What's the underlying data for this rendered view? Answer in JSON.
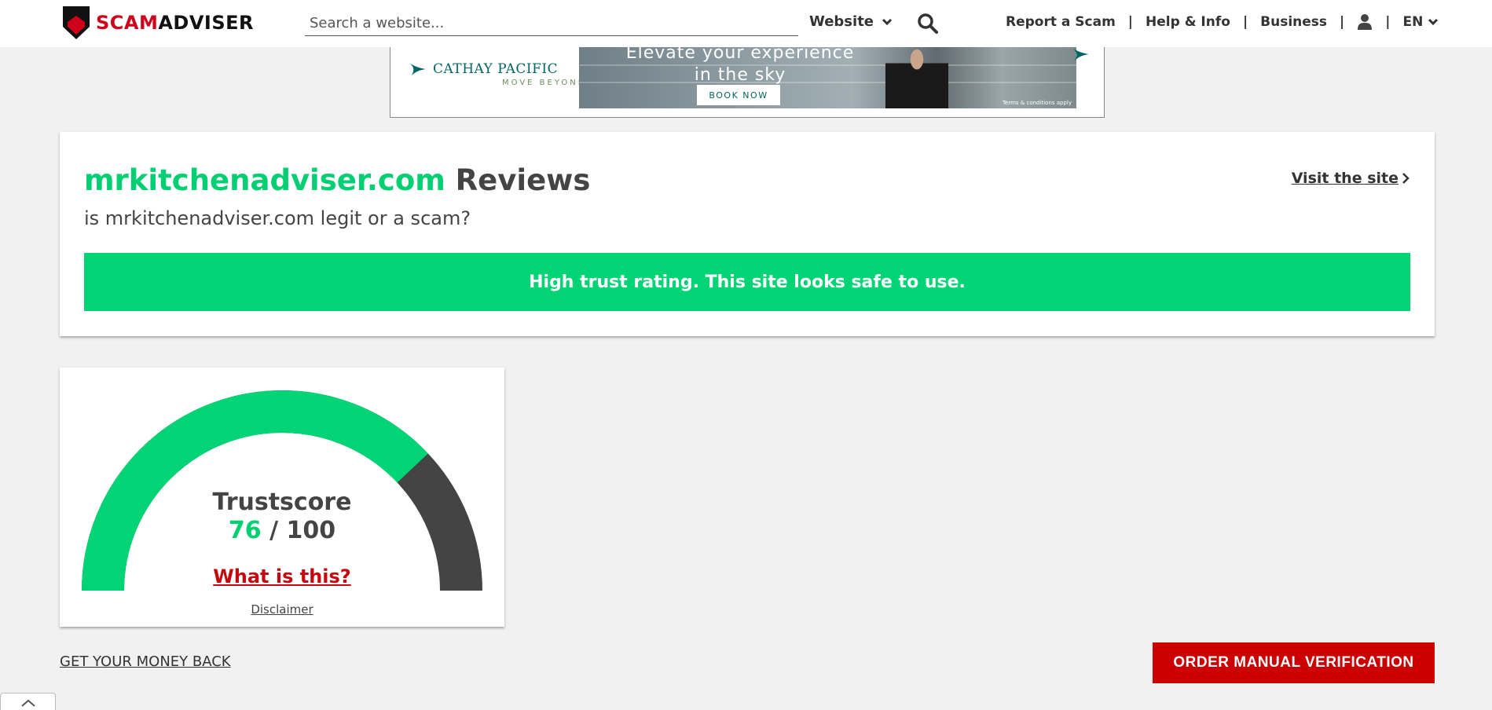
{
  "header": {
    "logo": {
      "part1": "SCAM",
      "part2": "ADVISER"
    },
    "search": {
      "placeholder": "Search a website...",
      "value": ""
    },
    "type_select": {
      "selected": "Website"
    },
    "nav": {
      "report": "Report a Scam",
      "help": "Help & Info",
      "business": "Business",
      "separator": "|",
      "lang": "EN"
    }
  },
  "ad": {
    "brand": "CATHAY PACIFIC",
    "tagline": "MOVE BEYOND",
    "headline_line1": "Elevate your experience",
    "headline_line2": "in the sky",
    "cta": "BOOK NOW",
    "terms": "Terms & conditions apply",
    "brand_color": "#006564"
  },
  "review": {
    "domain": "mrkitchenadviser.com",
    "title_suffix": " Reviews",
    "subtitle": "is mrkitchenadviser.com legit or a scam?",
    "visit_label": "Visit the site",
    "rating_text": "High trust rating. This site looks safe to use."
  },
  "trustscore": {
    "label": "Trustscore",
    "score": "76",
    "separator": " / ",
    "max": "100",
    "fraction": 0.76,
    "what_is_this": "What is this?",
    "disclaimer": "Disclaimer"
  },
  "footer": {
    "money_back": "GET YOUR MONEY BACK",
    "order_button": "ORDER MANUAL VERIFICATION"
  },
  "colors": {
    "accent_green": "#00d474",
    "brand_red": "#cc0000",
    "dark": "#444444"
  }
}
